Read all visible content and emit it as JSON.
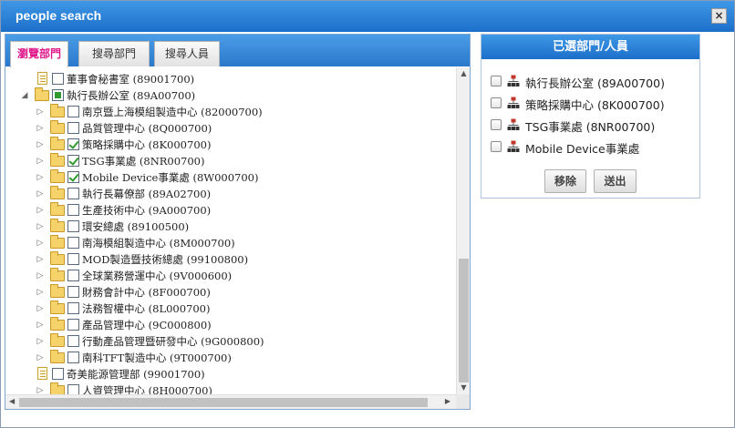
{
  "window": {
    "title": "people search",
    "close_label": "×"
  },
  "tabs": [
    {
      "label": "瀏覽部門",
      "active": true
    },
    {
      "label": "搜尋部門",
      "active": false
    },
    {
      "label": "搜尋人員",
      "active": false
    }
  ],
  "tree": {
    "nodes": [
      {
        "label": "董事會秘書室 (89001700)",
        "icon": "document-icon",
        "checked": "none",
        "expander": "none",
        "level": 1
      },
      {
        "label": "執行長辦公室 (89A00700)",
        "icon": "folder-open-icon",
        "checked": "partial",
        "expander": "expanded",
        "level": 0
      },
      {
        "label": "南京暨上海模組製造中心 (82000700)",
        "icon": "folder-icon",
        "checked": "none",
        "expander": "collapsed",
        "level": 1
      },
      {
        "label": "品質管理中心 (8Q000700)",
        "icon": "folder-icon",
        "checked": "none",
        "expander": "collapsed",
        "level": 1
      },
      {
        "label": "策略採購中心 (8K000700)",
        "icon": "folder-icon",
        "checked": "checked",
        "expander": "collapsed",
        "level": 1
      },
      {
        "label": "TSG事業處 (8NR00700)",
        "icon": "folder-icon",
        "checked": "checked",
        "expander": "collapsed",
        "level": 1
      },
      {
        "label": "Mobile Device事業處 (8W000700)",
        "icon": "folder-icon",
        "checked": "checked",
        "expander": "collapsed",
        "level": 1
      },
      {
        "label": "執行長幕僚部 (89A02700)",
        "icon": "folder-icon",
        "checked": "none",
        "expander": "collapsed",
        "level": 1
      },
      {
        "label": "生產技術中心 (9A000700)",
        "icon": "folder-icon",
        "checked": "none",
        "expander": "collapsed",
        "level": 1
      },
      {
        "label": "環安總處 (89100500)",
        "icon": "folder-icon",
        "checked": "none",
        "expander": "collapsed",
        "level": 1
      },
      {
        "label": "南海模組製造中心 (8M000700)",
        "icon": "folder-icon",
        "checked": "none",
        "expander": "collapsed",
        "level": 1
      },
      {
        "label": "MOD製造暨技術總處 (99100800)",
        "icon": "folder-icon",
        "checked": "none",
        "expander": "collapsed",
        "level": 1
      },
      {
        "label": "全球業務營運中心 (9V000600)",
        "icon": "folder-icon",
        "checked": "none",
        "expander": "collapsed",
        "level": 1
      },
      {
        "label": "財務會計中心 (8F000700)",
        "icon": "folder-icon",
        "checked": "none",
        "expander": "collapsed",
        "level": 1
      },
      {
        "label": "法務智權中心 (8L000700)",
        "icon": "folder-icon",
        "checked": "none",
        "expander": "collapsed",
        "level": 1
      },
      {
        "label": "產品管理中心 (9C000800)",
        "icon": "folder-icon",
        "checked": "none",
        "expander": "collapsed",
        "level": 1
      },
      {
        "label": "行動產品管理暨研發中心 (9G000800)",
        "icon": "folder-icon",
        "checked": "none",
        "expander": "collapsed",
        "level": 1
      },
      {
        "label": "南科TFT製造中心 (9T000700)",
        "icon": "folder-icon",
        "checked": "none",
        "expander": "collapsed",
        "level": 1
      },
      {
        "label": "奇美能源管理部 (99001700)",
        "icon": "document-icon",
        "checked": "none",
        "expander": "none",
        "level": 1
      },
      {
        "label": "人資管理中心 (8H000700)",
        "icon": "folder-icon",
        "checked": "none",
        "expander": "collapsed",
        "level": 1
      }
    ]
  },
  "selected_panel": {
    "title": "已選部門/人員",
    "items": [
      {
        "label": "執行長辦公室 (89A00700)",
        "icon": "org-chart-icon"
      },
      {
        "label": "策略採購中心 (8K000700)",
        "icon": "org-chart-icon"
      },
      {
        "label": "TSG事業處 (8NR00700)",
        "icon": "org-chart-icon"
      },
      {
        "label": "Mobile Device事業處",
        "icon": "org-chart-icon"
      }
    ],
    "remove_label": "移除",
    "submit_label": "送出"
  },
  "colors": {
    "header_blue": "#2a7fd6",
    "active_tab_text": "#e0188a",
    "check_green": "#2f9b2f"
  }
}
